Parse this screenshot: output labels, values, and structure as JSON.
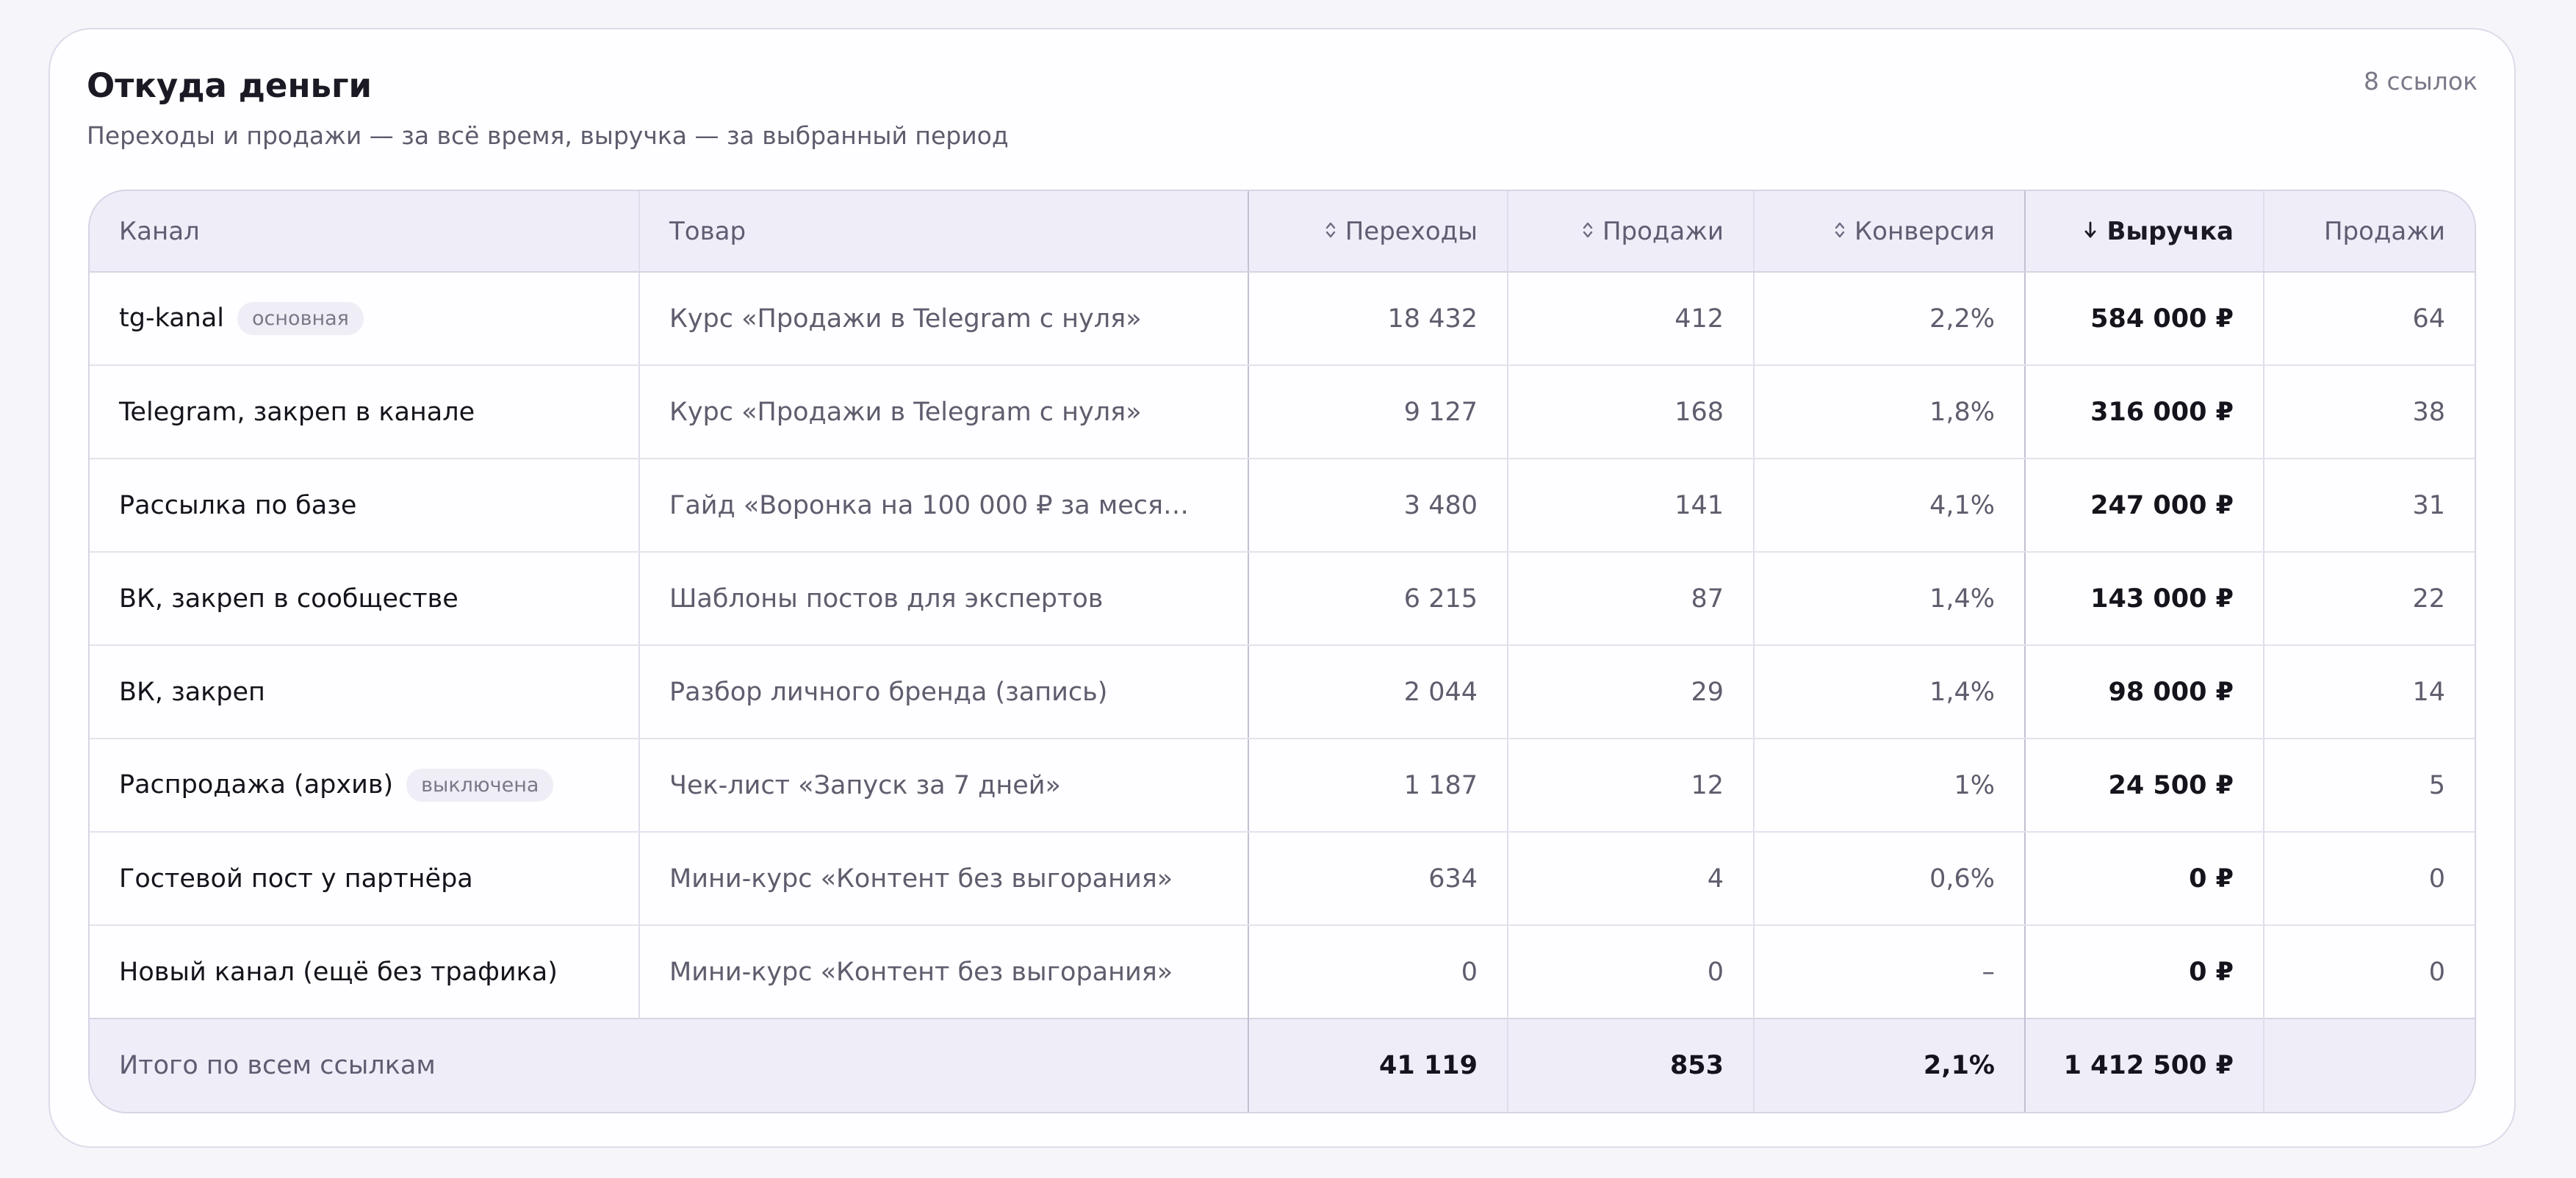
{
  "card": {
    "title": "Откуда деньги",
    "subtitle": "Переходы и продажи — за всё время, выручка — за выбранный период",
    "links_count": "8 ссылок"
  },
  "table": {
    "headers": {
      "channel": "Канал",
      "product": "Товар",
      "clicks": "Переходы",
      "sales": "Продажи",
      "conversion": "Конверсия",
      "revenue": "Выручка",
      "sales_period": "Продажи"
    },
    "sort_icons": {
      "clicks": "sort-both-icon",
      "sales": "sort-both-icon",
      "conversion": "sort-both-icon",
      "revenue": "arrow-down-icon"
    },
    "rows": [
      {
        "channel": "tg-kanal",
        "badge": "основная",
        "product": "Курс «Продажи в Telegram с нуля»",
        "clicks": "18 432",
        "sales": "412",
        "conversion": "2,2%",
        "revenue": "584 000 ₽",
        "sales_period": "64"
      },
      {
        "channel": "Telegram, закреп в канале",
        "badge": "",
        "product": "Курс «Продажи в Telegram с нуля»",
        "clicks": "9 127",
        "sales": "168",
        "conversion": "1,8%",
        "revenue": "316 000 ₽",
        "sales_period": "38"
      },
      {
        "channel": "Рассылка по базе",
        "badge": "",
        "product": "Гайд «Воронка на 100 000 ₽ за меся…",
        "clicks": "3 480",
        "sales": "141",
        "conversion": "4,1%",
        "revenue": "247 000 ₽",
        "sales_period": "31"
      },
      {
        "channel": "ВК, закреп в сообществе",
        "badge": "",
        "product": "Шаблоны постов для экспертов",
        "clicks": "6 215",
        "sales": "87",
        "conversion": "1,4%",
        "revenue": "143 000 ₽",
        "sales_period": "22"
      },
      {
        "channel": "ВК, закреп",
        "badge": "",
        "product": "Разбор личного бренда (запись)",
        "clicks": "2 044",
        "sales": "29",
        "conversion": "1,4%",
        "revenue": "98 000 ₽",
        "sales_period": "14"
      },
      {
        "channel": "Распродажа (архив)",
        "badge": "выключена",
        "product": "Чек-лист «Запуск за 7 дней»",
        "clicks": "1 187",
        "sales": "12",
        "conversion": "1%",
        "revenue": "24 500 ₽",
        "sales_period": "5"
      },
      {
        "channel": "Гостевой пост у партнёра",
        "badge": "",
        "product": "Мини-курс «Контент без выгорания»",
        "clicks": "634",
        "sales": "4",
        "conversion": "0,6%",
        "revenue": "0 ₽",
        "sales_period": "0"
      },
      {
        "channel": "Новый канал (ещё без трафика)",
        "badge": "",
        "product": "Мини-курс «Контент без выгорания»",
        "clicks": "0",
        "sales": "0",
        "conversion": "–",
        "revenue": "0 ₽",
        "sales_period": "0"
      }
    ],
    "totals": {
      "label": "Итого по всем ссылкам",
      "clicks": "41 119",
      "sales": "853",
      "conversion": "2,1%",
      "revenue": "1 412 500 ₽",
      "sales_period": ""
    }
  }
}
